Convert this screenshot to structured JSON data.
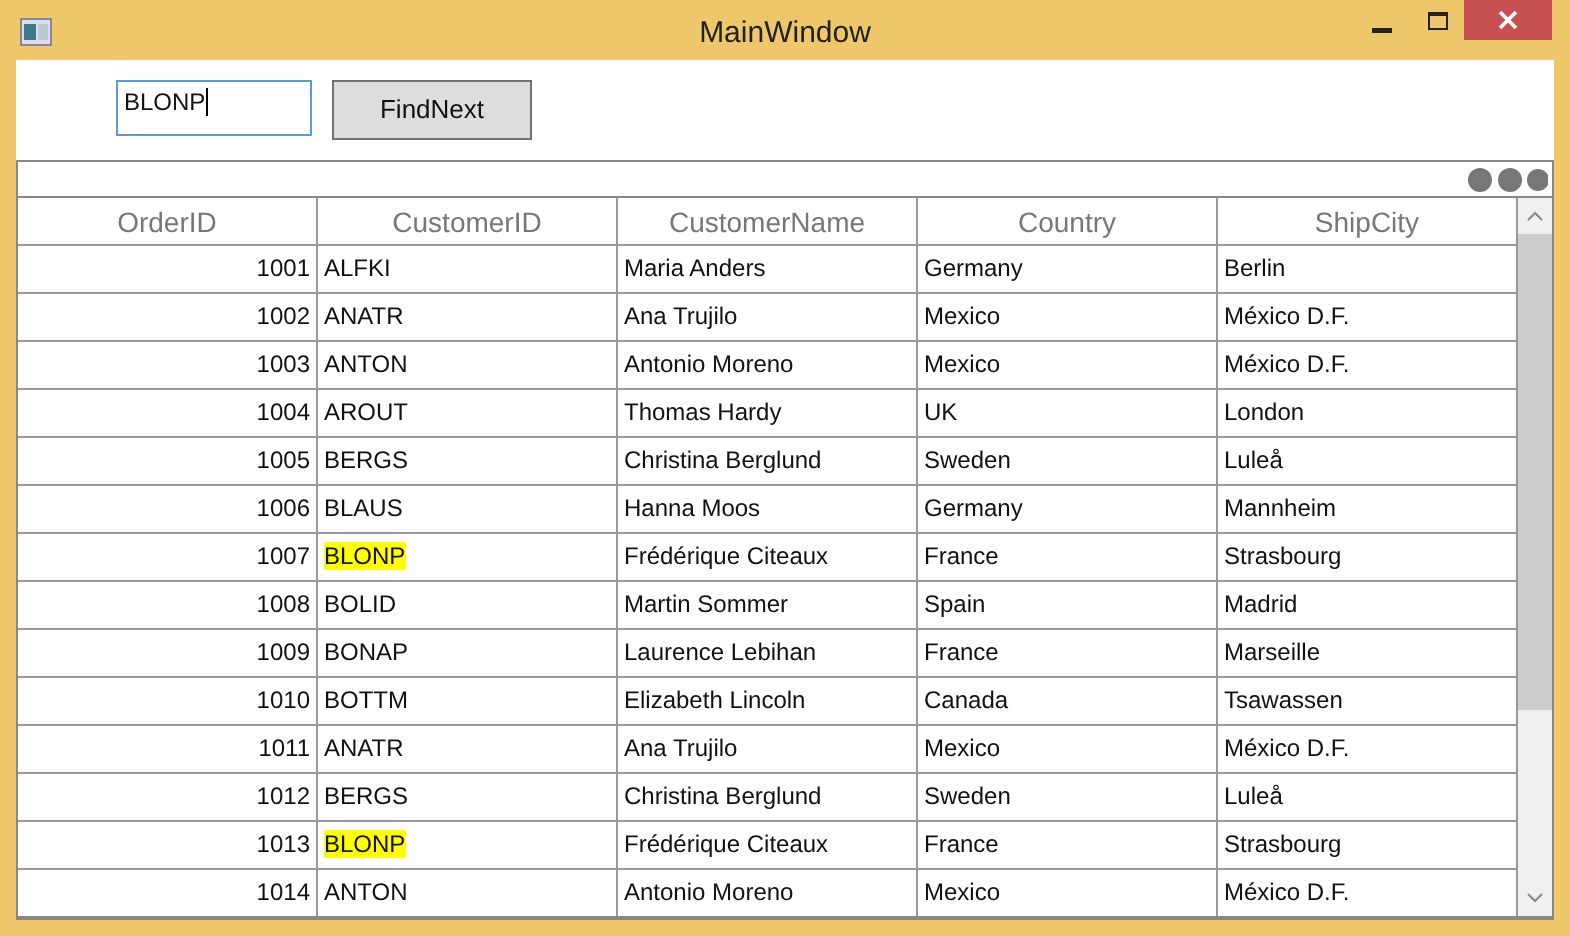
{
  "window": {
    "title": "MainWindow"
  },
  "search": {
    "value": "BLONP"
  },
  "buttons": [
    "FindNext"
  ],
  "table": {
    "columns": [
      "OrderID",
      "CustomerID",
      "CustomerName",
      "Country",
      "ShipCity"
    ],
    "rows": [
      {
        "cells": [
          "1001",
          "ALFKI",
          "Maria Anders",
          "Germany",
          "Berlin"
        ],
        "highlighted": false
      },
      {
        "cells": [
          "1002",
          "ANATR",
          "Ana Trujilo",
          "Mexico",
          "México D.F."
        ],
        "highlighted": false
      },
      {
        "cells": [
          "1003",
          "ANTON",
          "Antonio Moreno",
          "Mexico",
          "México D.F."
        ],
        "highlighted": false
      },
      {
        "cells": [
          "1004",
          "AROUT",
          "Thomas Hardy",
          "UK",
          "London"
        ],
        "highlighted": false
      },
      {
        "cells": [
          "1005",
          "BERGS",
          "Christina Berglund",
          "Sweden",
          "Luleå"
        ],
        "highlighted": false
      },
      {
        "cells": [
          "1006",
          "BLAUS",
          "Hanna Moos",
          "Germany",
          "Mannheim"
        ],
        "highlighted": false
      },
      {
        "cells": [
          "1007",
          "BLONP",
          "Frédérique Citeaux",
          "France",
          "Strasbourg"
        ],
        "highlighted": true
      },
      {
        "cells": [
          "1008",
          "BOLID",
          "Martin Sommer",
          "Spain",
          "Madrid"
        ],
        "highlighted": false
      },
      {
        "cells": [
          "1009",
          "BONAP",
          "Laurence Lebihan",
          "France",
          "Marseille"
        ],
        "highlighted": false
      },
      {
        "cells": [
          "1010",
          "BOTTM",
          "Elizabeth Lincoln",
          "Canada",
          "Tsawassen"
        ],
        "highlighted": false
      },
      {
        "cells": [
          "1011",
          "ANATR",
          "Ana Trujilo",
          "Mexico",
          "México D.F."
        ],
        "highlighted": false
      },
      {
        "cells": [
          "1012",
          "BERGS",
          "Christina Berglund",
          "Sweden",
          "Luleå"
        ],
        "highlighted": false
      },
      {
        "cells": [
          "1013",
          "BLONP",
          "Frédérique Citeaux",
          "France",
          "Strasbourg"
        ],
        "highlighted": true
      },
      {
        "cells": [
          "1014",
          "ANTON",
          "Antonio Moreno",
          "Mexico",
          "México D.F."
        ],
        "highlighted": false
      }
    ]
  }
}
